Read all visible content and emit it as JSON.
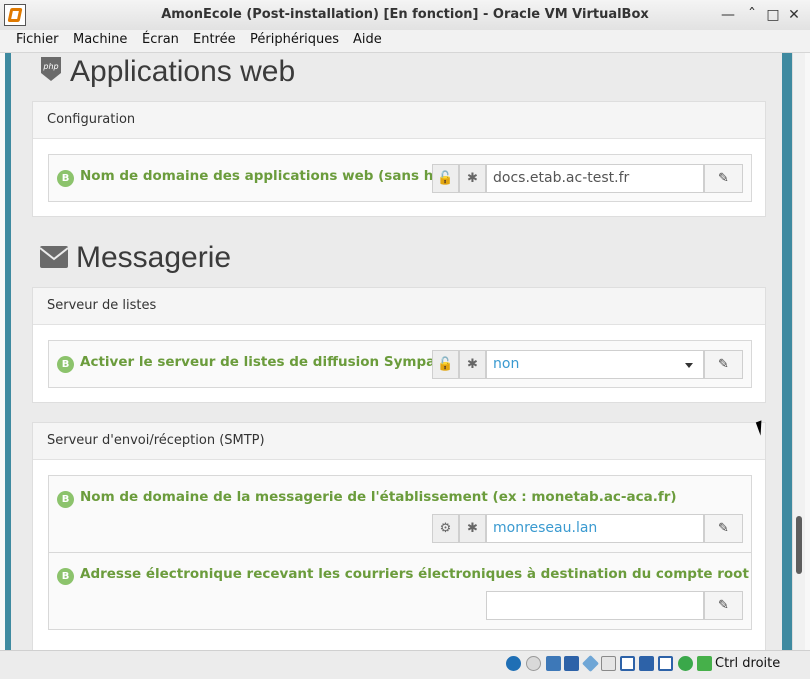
{
  "window": {
    "title": "AmonEcole (Post-installation) [En fonction] - Oracle VM VirtualBox"
  },
  "menubar": {
    "items": [
      "Fichier",
      "Machine",
      "Écran",
      "Entrée",
      "Périphériques",
      "Aide"
    ]
  },
  "sections": {
    "web": {
      "title": "Applications web",
      "icon_text": "php",
      "panel_title": "Configuration",
      "field": {
        "badge": "B",
        "label": "Nom de domaine des applications web (sans http://)",
        "value": "docs.etab.ac-test.fr"
      }
    },
    "mail": {
      "title": "Messagerie",
      "lists_panel_title": "Serveur de listes",
      "lists_field": {
        "badge": "B",
        "label": "Activer le serveur de listes de diffusion Sympa",
        "value": "non"
      },
      "smtp_panel_title": "Serveur d'envoi/réception (SMTP)",
      "smtp_domain_field": {
        "badge": "B",
        "label": "Nom de domaine de la messagerie de l'établissement (ex : monetab.ac-aca.fr)",
        "value": "monreseau.lan"
      },
      "smtp_root_field": {
        "badge": "B",
        "label": "Adresse électronique recevant les courriers électroniques à destination du compte root",
        "value": ""
      }
    }
  },
  "statusbar": {
    "host_key": "Ctrl droite"
  },
  "colors": {
    "accent_bar": "#3f8aa0",
    "label_green": "#6b9c3c",
    "badge_green": "#8cc36c",
    "value_blue": "#3a9ad0"
  }
}
